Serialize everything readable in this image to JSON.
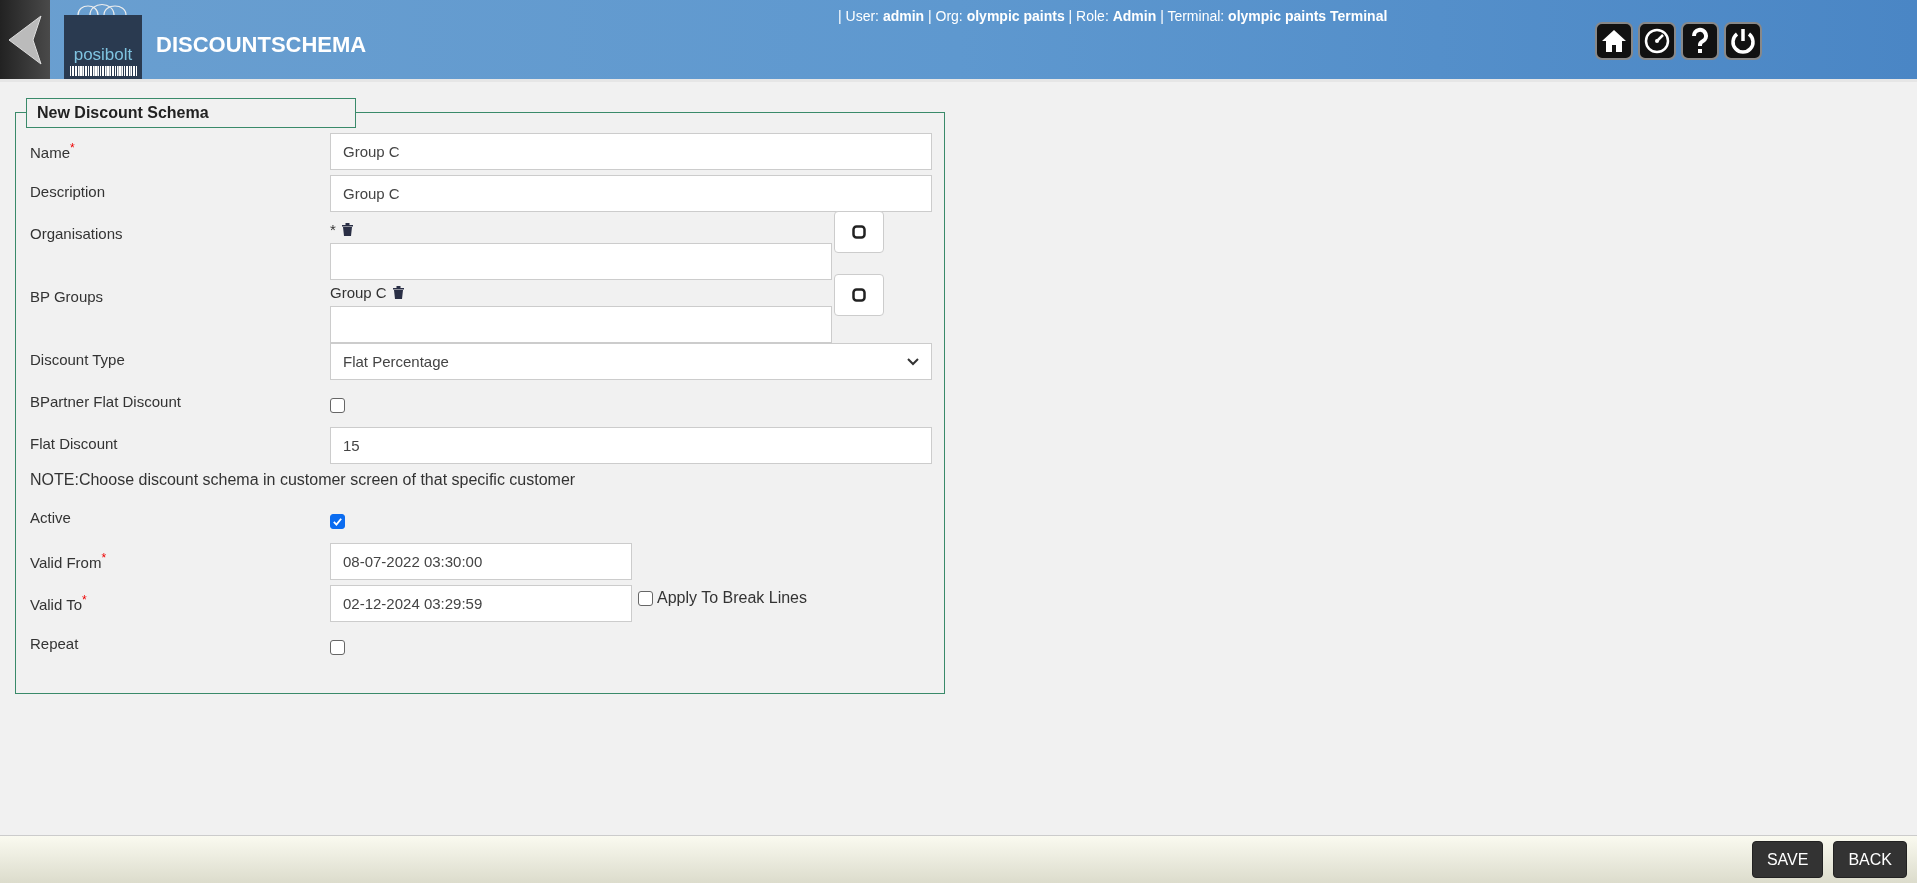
{
  "header": {
    "logo_text": "posibolt",
    "title": "DISCOUNTSCHEMA",
    "user_info": "| User: **admin** | Org: **olympic paints** | Role: **Admin** | Terminal: **olympic paints Terminal**"
  },
  "form": {
    "legend": "New Discount Schema",
    "fields": [
      {
        "kind": "text",
        "label": "Name$^{*}$",
        "value": "Group C"
      },
      {
        "kind": "text",
        "label": "Description",
        "value": "Group C"
      },
      {
        "kind": "multi",
        "label": "Organisations",
        "tags": [
          "*"
        ]
      },
      {
        "kind": "multi",
        "label": "BP Groups",
        "tags": [
          "Group C"
        ]
      },
      {
        "kind": "select",
        "label": "Discount Type",
        "value": "Flat Percentage"
      },
      {
        "kind": "checkbox",
        "label": "BPartner Flat Discount",
        "checked": false
      },
      {
        "kind": "text",
        "label": "Flat Discount",
        "value": "15"
      },
      {
        "kind": "note",
        "text": "NOTE:Choose discount schema in customer screen of that specific customer"
      },
      {
        "kind": "checkbox",
        "label": "Active",
        "checked": true
      },
      {
        "kind": "date",
        "label": "Valid From$^{*}$",
        "value": "08-07-2022 03:30:00"
      },
      {
        "kind": "date",
        "label": "Valid To$^{*}$",
        "value": "02-12-2024 03:29:59",
        "extra": {
          "label": "Apply To Break Lines",
          "checked": false
        }
      },
      {
        "kind": "checkbox",
        "label": "Repeat",
        "checked": false
      }
    ]
  },
  "footer": {
    "buttons": [
      "SAVE",
      "BACK"
    ]
  }
}
